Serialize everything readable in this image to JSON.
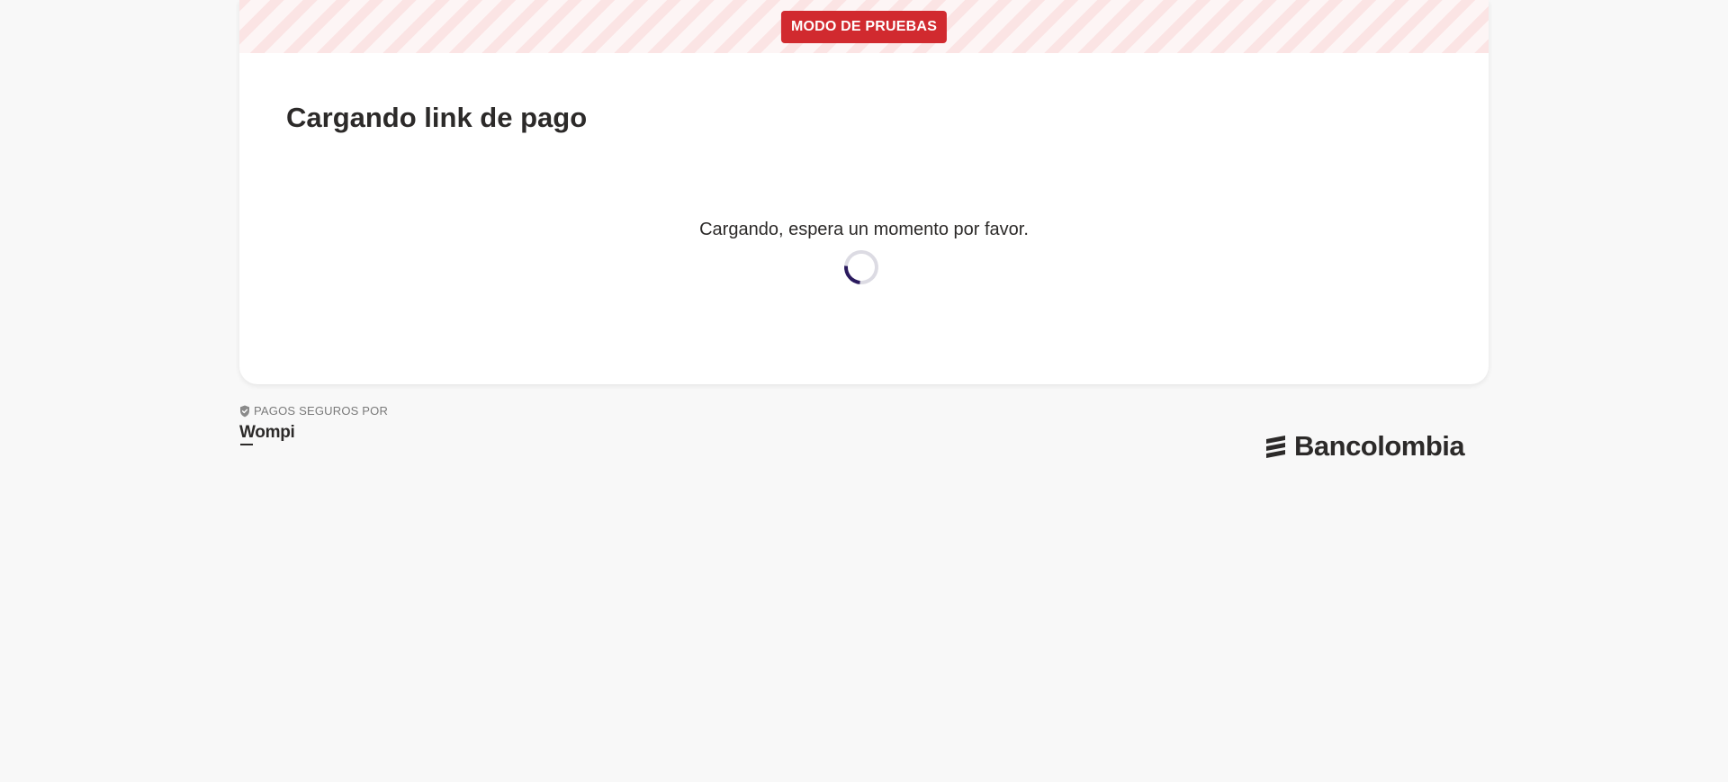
{
  "banner": {
    "badge_label": "MODO DE PRUEBAS",
    "badge_color": "#d12a2f"
  },
  "main": {
    "title": "Cargando link de pago",
    "loading_message": "Cargando, espera un momento por favor."
  },
  "footer": {
    "secure_label": "PAGOS SEGUROS POR",
    "secure_icon": "shield-check-icon",
    "provider_name": "Wompi",
    "bank_name": "Bancolombia",
    "bank_icon": "bancolombia-logo-icon"
  },
  "colors": {
    "page_background": "#f8f8f8",
    "card_background": "#ffffff",
    "text_primary": "#2c2a29",
    "spinner_accent": "#2a1a5e",
    "spinner_track": "#dcdbe3"
  }
}
